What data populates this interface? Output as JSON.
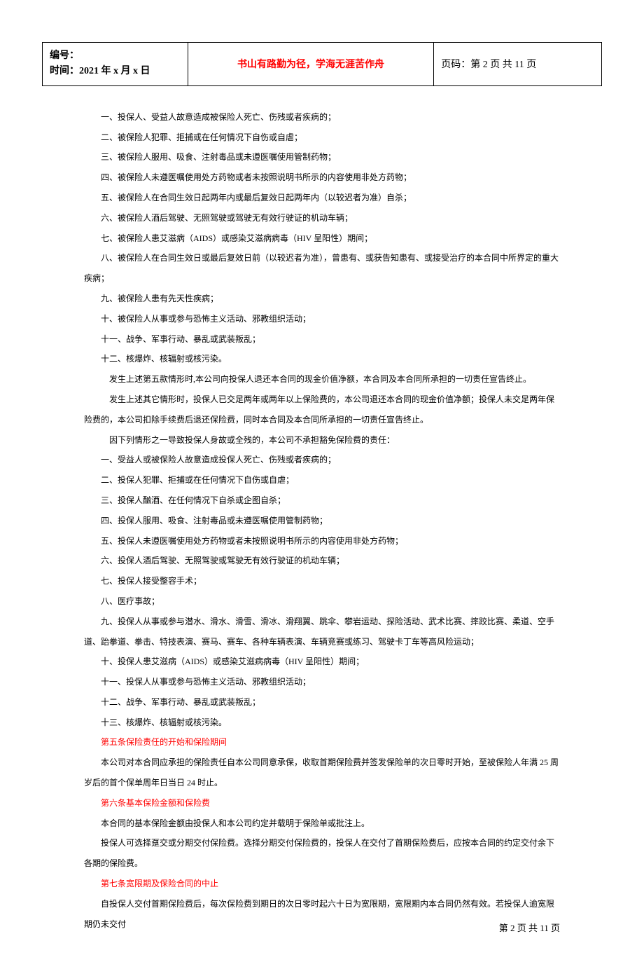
{
  "header": {
    "left_line1": "编号：",
    "left_line2": "时间：2021 年 x 月 x 日",
    "center": "书山有路勤为径，学海无涯苦作舟",
    "right": "页码：第 2 页 共 11 页"
  },
  "body": {
    "items_a": [
      "一、投保人、受益人故意造成被保险人死亡、伤残或者疾病的；",
      "二、被保险人犯罪、拒捕或在任何情况下自伤或自虐；",
      "三、被保险人服用、吸食、注射毒品或未遵医嘱使用管制药物；",
      "四、被保险人未遵医嘱使用处方药物或者未按照说明书所示的内容使用非处方药物；",
      "五、被保险人在合同生效日起两年内或最后复效日起两年内（以较迟者为准）自杀；",
      "六、被保险人酒后驾驶、无照驾驶或驾驶无有效行驶证的机动车辆；",
      "七、被保险人患艾滋病（AIDS）或感染艾滋病病毒（HIV 呈阳性）期间；",
      "八、被保险人在合同生效日或最后复效日前（以较迟者为准），曾患有、或获告知患有、或接受治疗的本合同中所界定的重大疾病；",
      "九、被保险人患有先天性疾病；",
      "十、被保险人从事或参与恐怖主义活动、邪教组织活动；",
      "十一、战争、军事行动、暴乱或武装叛乱；",
      "十二、核爆炸、核辐射或核污染。"
    ],
    "para_a1": "发生上述第五款情形时,本公司向投保人退还本合同的现金价值净额，本合同及本合同所承担的一切责任宣告终止。",
    "para_a2": "发生上述其它情形时，投保人已交足两年或两年以上保险费的，本公司退还本合同的现金价值净额；投保人未交足两年保险费的，本公司扣除手续费后退还保险费，同时本合同及本合同所承担的一切责任宣告终止。",
    "para_b_intro": "因下列情形之一导致投保人身故或全残的，本公司不承担豁免保险费的责任：",
    "items_b": [
      "一、受益人或被保险人故意造成投保人死亡、伤残或者疾病的；",
      "二、投保人犯罪、拒捕或在任何情况下自伤或自虐；",
      "三、投保人酗酒、在任何情况下自杀或企图自杀；",
      "四、投保人服用、吸食、注射毒品或未遵医嘱使用管制药物；",
      "五、投保人未遵医嘱使用处方药物或者未按照说明书所示的内容使用非处方药物；",
      "六、投保人酒后驾驶、无照驾驶或驾驶无有效行驶证的机动车辆；",
      "七、投保人接受整容手术；",
      "八、医疗事故；",
      "九、投保人从事或参与潜水、滑水、滑雪、滑冰、滑翔翼、跳伞、攀岩运动、探险活动、武术比赛、摔跤比赛、柔道、空手道、跆拳道、拳击、特技表演、赛马、赛车、各种车辆表演、车辆竞赛或练习、驾驶卡丁车等高风险运动；",
      "十、投保人患艾滋病（AIDS）或感染艾滋病病毒（HIV 呈阳性）期间；",
      "十一、投保人从事或参与恐怖主义活动、邪教组织活动；",
      "十二、战争、军事行动、暴乱或武装叛乱；",
      "十三、核爆炸、核辐射或核污染。"
    ]
  },
  "sections": {
    "s5": {
      "heading": "第五条保险责任的开始和保险期间",
      "para": "本公司对本合同应承担的保险责任自本公司同意承保，收取首期保险费并签发保险单的次日零时开始，至被保险人年满 25 周岁后的首个保单周年日当日 24 时止。"
    },
    "s6": {
      "heading": "第六条基本保险金额和保险费",
      "para1": "本合同的基本保险金额由投保人和本公司约定并载明于保险单或批注上。",
      "para2": "投保人可选择趸交或分期交付保险费。选择分期交付保险费的，投保人在交付了首期保险费后，应按本合同的约定交付余下各期的保险费。"
    },
    "s7": {
      "heading": "第七条宽限期及保险合同的中止",
      "para": "自投保人交付首期保险费后，每次保险费到期日的次日零时起六十日为宽限期，宽限期内本合同仍然有效。若投保人逾宽限期仍未交付"
    }
  },
  "footer": "第 2 页 共 11 页"
}
